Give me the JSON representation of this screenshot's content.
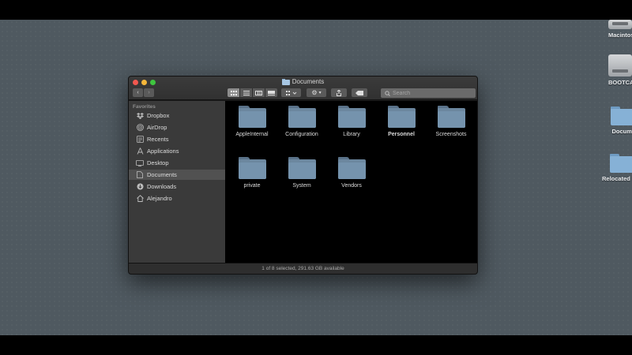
{
  "desktop": {
    "icons": [
      {
        "label": "Macintosh",
        "kind": "drive"
      },
      {
        "label": "BOOTCAMP",
        "kind": "drive"
      },
      {
        "label": "Documents",
        "kind": "folder"
      },
      {
        "label": "Relocated Items",
        "kind": "folder"
      }
    ]
  },
  "window": {
    "title": "Documents",
    "search": {
      "placeholder": "Search",
      "value": ""
    },
    "toolbar": {
      "back_icon": "chevron-left-icon",
      "forward_icon": "chevron-right-icon",
      "views": [
        "icon-view-icon",
        "list-view-icon",
        "column-view-icon",
        "gallery-view-icon"
      ],
      "active_view": 0
    },
    "sidebar": {
      "header": "Favorites",
      "items": [
        {
          "label": "Dropbox",
          "icon": "dropbox-icon"
        },
        {
          "label": "AirDrop",
          "icon": "airdrop-icon"
        },
        {
          "label": "Recents",
          "icon": "clock-icon"
        },
        {
          "label": "Applications",
          "icon": "applications-icon"
        },
        {
          "label": "Desktop",
          "icon": "desktop-icon"
        },
        {
          "label": "Documents",
          "icon": "document-icon",
          "selected": true
        },
        {
          "label": "Downloads",
          "icon": "download-icon"
        },
        {
          "label": "Alejandro",
          "icon": "home-icon"
        }
      ]
    },
    "folders": [
      {
        "name": "AppleInternal"
      },
      {
        "name": "Configuration"
      },
      {
        "name": "Library"
      },
      {
        "name": "Personnel"
      },
      {
        "name": "Screenshots"
      },
      {
        "name": "private"
      },
      {
        "name": "System"
      },
      {
        "name": "Vendors"
      }
    ],
    "status": "1 of 8 selected, 291.63 GB available"
  },
  "colors": {
    "desktop_bg": "#4f5960",
    "folder_blue": "#7593ad",
    "sidebar_bg": "#3a3a3a",
    "content_bg": "#000000"
  }
}
